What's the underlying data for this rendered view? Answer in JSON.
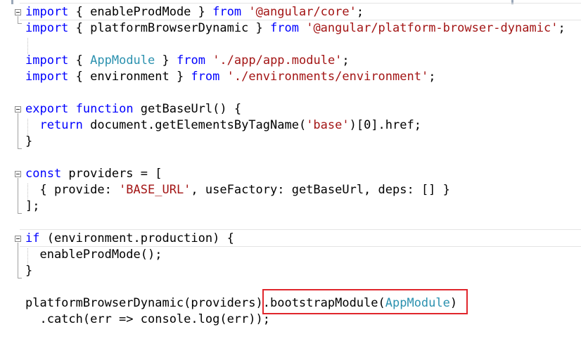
{
  "editor": {
    "lines": [
      [
        {
          "t": "import",
          "c": "kw"
        },
        {
          "t": " { enableProdMode } ",
          "c": "plain"
        },
        {
          "t": "from",
          "c": "kw"
        },
        {
          "t": " ",
          "c": "plain"
        },
        {
          "t": "'@angular/core'",
          "c": "str"
        },
        {
          "t": ";",
          "c": "plain"
        }
      ],
      [
        {
          "t": "import",
          "c": "kw"
        },
        {
          "t": " { platformBrowserDynamic } ",
          "c": "plain"
        },
        {
          "t": "from",
          "c": "kw"
        },
        {
          "t": " ",
          "c": "plain"
        },
        {
          "t": "'@angular/platform-browser-dynamic'",
          "c": "str"
        },
        {
          "t": ";",
          "c": "plain"
        }
      ],
      [],
      [
        {
          "t": "import",
          "c": "kw"
        },
        {
          "t": " { ",
          "c": "plain"
        },
        {
          "t": "AppModule",
          "c": "type"
        },
        {
          "t": " } ",
          "c": "plain"
        },
        {
          "t": "from",
          "c": "kw"
        },
        {
          "t": " ",
          "c": "plain"
        },
        {
          "t": "'./app/app.module'",
          "c": "str"
        },
        {
          "t": ";",
          "c": "plain"
        }
      ],
      [
        {
          "t": "import",
          "c": "kw"
        },
        {
          "t": " { environment } ",
          "c": "plain"
        },
        {
          "t": "from",
          "c": "kw"
        },
        {
          "t": " ",
          "c": "plain"
        },
        {
          "t": "'./environments/environment'",
          "c": "str"
        },
        {
          "t": ";",
          "c": "plain"
        }
      ],
      [],
      [
        {
          "t": "export",
          "c": "kw"
        },
        {
          "t": " ",
          "c": "plain"
        },
        {
          "t": "function",
          "c": "kw"
        },
        {
          "t": " getBaseUrl() {",
          "c": "plain"
        }
      ],
      [
        {
          "t": "  ",
          "c": "plain"
        },
        {
          "t": "return",
          "c": "kw"
        },
        {
          "t": " document.getElementsByTagName(",
          "c": "plain"
        },
        {
          "t": "'base'",
          "c": "str"
        },
        {
          "t": ")[0].href;",
          "c": "plain"
        }
      ],
      [
        {
          "t": "}",
          "c": "plain"
        }
      ],
      [],
      [
        {
          "t": "const",
          "c": "kw"
        },
        {
          "t": " providers = [",
          "c": "plain"
        }
      ],
      [
        {
          "t": "  { provide: ",
          "c": "plain"
        },
        {
          "t": "'BASE_URL'",
          "c": "str"
        },
        {
          "t": ", useFactory: getBaseUrl, deps: [] }",
          "c": "plain"
        }
      ],
      [
        {
          "t": "];",
          "c": "plain"
        }
      ],
      [],
      [
        {
          "t": "if",
          "c": "kw"
        },
        {
          "t": " (environment.production) {",
          "c": "plain"
        }
      ],
      [
        {
          "t": "  enableProdMode();",
          "c": "plain"
        }
      ],
      [
        {
          "t": "}",
          "c": "plain"
        }
      ],
      [],
      [
        {
          "t": "platformBrowserDynamic(providers).bootstrapModule(",
          "c": "plain"
        },
        {
          "t": "AppModule",
          "c": "type"
        },
        {
          "t": ")",
          "c": "plain"
        }
      ],
      [
        {
          "t": "  .catch(err => console.log(err));",
          "c": "plain"
        }
      ]
    ]
  },
  "colors": {
    "keyword": "#0000ff",
    "string": "#a31515",
    "type": "#2b91af",
    "highlight_border": "#e0262c"
  }
}
